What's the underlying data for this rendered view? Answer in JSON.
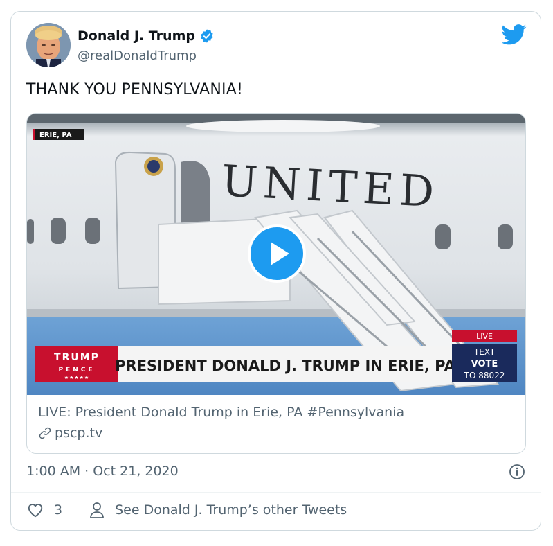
{
  "tweet": {
    "author_name": "Donald J. Trump",
    "handle": "@realDonaldTrump",
    "text": "THANK YOU PENNSYLVANIA!",
    "timestamp": "1:00 AM · Oct 21, 2020",
    "like_count": "3",
    "other_tweets_label": "See Donald J. Trump’s other Tweets"
  },
  "media": {
    "location_tag": "ERIE, PA",
    "livery_text": "UNITED",
    "logo_line1": "TRUMP",
    "logo_line2": "PENCE",
    "logo_stars": "★★★★★",
    "headline": "PRESIDENT DONALD J. TRUMP IN ERIE, PA",
    "live_badge": "LIVE",
    "text_line": "TEXT",
    "vote_line": "VOTE",
    "number_line": "TO 88022"
  },
  "link_card": {
    "title": "LIVE: President Donald Trump in Erie, PA #Pennsylvania",
    "domain": "pscp.tv"
  },
  "colors": {
    "brand_blue": "#1d9bf0",
    "secondary_text": "#536471",
    "banner_red": "#c8102e",
    "banner_navy": "#1a2a5c"
  }
}
